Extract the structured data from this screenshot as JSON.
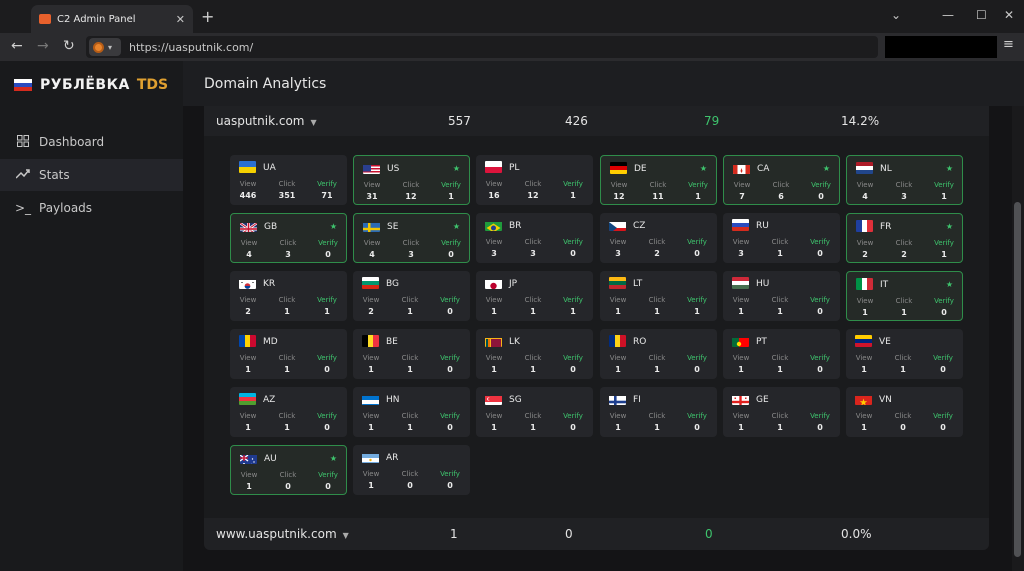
{
  "browser": {
    "tab_title": "C2 Admin Panel",
    "url": "https://uasputnik.com/"
  },
  "sidebar": {
    "brand_name": "РУБЛЁВКА",
    "brand_suffix": "TDS",
    "items": [
      {
        "label": "Dashboard",
        "icon": "grid-icon"
      },
      {
        "label": "Stats",
        "icon": "trend-icon"
      },
      {
        "label": "Payloads",
        "icon": "terminal-icon"
      }
    ]
  },
  "header": {
    "title": "Domain Analytics"
  },
  "labels": {
    "view": "View",
    "click": "Click",
    "verify": "Verify"
  },
  "domains": [
    {
      "name": "uasputnik.com",
      "views": "557",
      "clicks": "426",
      "verifies": "79",
      "rate": "14.2%"
    },
    {
      "name": "www.uasputnik.com",
      "views": "1",
      "clicks": "0",
      "verifies": "0",
      "rate": "0.0%"
    }
  ],
  "countries": [
    {
      "code": "UA",
      "view": "446",
      "click": "351",
      "verify": "71",
      "star": false
    },
    {
      "code": "US",
      "view": "31",
      "click": "12",
      "verify": "1",
      "star": true
    },
    {
      "code": "PL",
      "view": "16",
      "click": "12",
      "verify": "1",
      "star": false
    },
    {
      "code": "DE",
      "view": "12",
      "click": "11",
      "verify": "1",
      "star": true
    },
    {
      "code": "CA",
      "view": "7",
      "click": "6",
      "verify": "0",
      "star": true
    },
    {
      "code": "NL",
      "view": "4",
      "click": "3",
      "verify": "1",
      "star": true
    },
    {
      "code": "GB",
      "view": "4",
      "click": "3",
      "verify": "0",
      "star": true
    },
    {
      "code": "SE",
      "view": "4",
      "click": "3",
      "verify": "0",
      "star": true
    },
    {
      "code": "BR",
      "view": "3",
      "click": "3",
      "verify": "0",
      "star": false
    },
    {
      "code": "CZ",
      "view": "3",
      "click": "2",
      "verify": "0",
      "star": false
    },
    {
      "code": "RU",
      "view": "3",
      "click": "1",
      "verify": "0",
      "star": false
    },
    {
      "code": "FR",
      "view": "2",
      "click": "2",
      "verify": "1",
      "star": true
    },
    {
      "code": "KR",
      "view": "2",
      "click": "1",
      "verify": "1",
      "star": false
    },
    {
      "code": "BG",
      "view": "2",
      "click": "1",
      "verify": "0",
      "star": false
    },
    {
      "code": "JP",
      "view": "1",
      "click": "1",
      "verify": "1",
      "star": false
    },
    {
      "code": "LT",
      "view": "1",
      "click": "1",
      "verify": "1",
      "star": false
    },
    {
      "code": "HU",
      "view": "1",
      "click": "1",
      "verify": "0",
      "star": false
    },
    {
      "code": "IT",
      "view": "1",
      "click": "1",
      "verify": "0",
      "star": true
    },
    {
      "code": "MD",
      "view": "1",
      "click": "1",
      "verify": "0",
      "star": false
    },
    {
      "code": "BE",
      "view": "1",
      "click": "1",
      "verify": "0",
      "star": false
    },
    {
      "code": "LK",
      "view": "1",
      "click": "1",
      "verify": "0",
      "star": false
    },
    {
      "code": "RO",
      "view": "1",
      "click": "1",
      "verify": "0",
      "star": false
    },
    {
      "code": "PT",
      "view": "1",
      "click": "1",
      "verify": "0",
      "star": false
    },
    {
      "code": "VE",
      "view": "1",
      "click": "1",
      "verify": "0",
      "star": false
    },
    {
      "code": "AZ",
      "view": "1",
      "click": "1",
      "verify": "0",
      "star": false
    },
    {
      "code": "HN",
      "view": "1",
      "click": "1",
      "verify": "0",
      "star": false
    },
    {
      "code": "SG",
      "view": "1",
      "click": "1",
      "verify": "0",
      "star": false
    },
    {
      "code": "FI",
      "view": "1",
      "click": "1",
      "verify": "0",
      "star": false
    },
    {
      "code": "GE",
      "view": "1",
      "click": "1",
      "verify": "0",
      "star": false
    },
    {
      "code": "VN",
      "view": "1",
      "click": "0",
      "verify": "0",
      "star": false
    },
    {
      "code": "AU",
      "view": "1",
      "click": "0",
      "verify": "0",
      "star": true
    },
    {
      "code": "AR",
      "view": "1",
      "click": "0",
      "verify": "0",
      "star": false
    }
  ],
  "colors": {
    "accent_green": "#3ec46d",
    "brand_gold": "#e0a030",
    "highlight_border": "#2f8d4a"
  }
}
